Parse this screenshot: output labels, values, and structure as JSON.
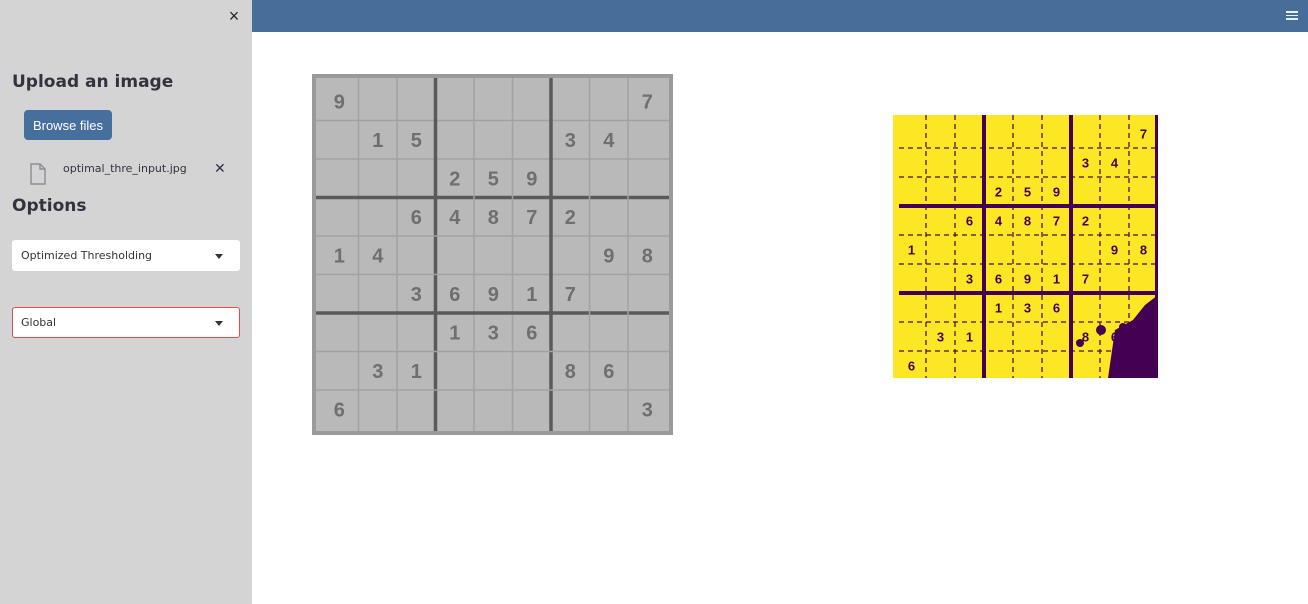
{
  "sidebar": {
    "close_icon": "close-icon",
    "upload_heading": "Upload an image",
    "browse_label": "Browse files",
    "file_name": "optimal_thre_input.jpg",
    "file_icon": "file-icon",
    "file_remove_icon": "close-icon",
    "options_heading": "Options",
    "method_select": {
      "value": "Optimized Thresholding"
    },
    "scope_select": {
      "value": "Global"
    }
  },
  "header": {
    "menu_icon": "hamburger-menu-icon",
    "color": "#476d99"
  },
  "images": {
    "input": {
      "grid": [
        [
          "9",
          "",
          "",
          "",
          "",
          "",
          "",
          "",
          "7"
        ],
        [
          "",
          "1",
          "5",
          "",
          "",
          "",
          "3",
          "4",
          ""
        ],
        [
          "",
          "",
          "",
          "2",
          "5",
          "9",
          "",
          "",
          ""
        ],
        [
          "",
          "",
          "6",
          "4",
          "8",
          "7",
          "2",
          "",
          ""
        ],
        [
          "1",
          "4",
          "",
          "",
          "",
          "",
          "",
          "9",
          "8"
        ],
        [
          "",
          "",
          "3",
          "6",
          "9",
          "1",
          "7",
          "",
          ""
        ],
        [
          "",
          "",
          "",
          "1",
          "3",
          "6",
          "",
          "",
          ""
        ],
        [
          "",
          "3",
          "1",
          "",
          "",
          "",
          "8",
          "6",
          ""
        ],
        [
          "6",
          "",
          "",
          "",
          "",
          "",
          "",
          "",
          "3"
        ]
      ]
    },
    "output": {
      "foreground": "#440154",
      "background": "#fde725",
      "digits": [
        {
          "t": "7",
          "c": 8,
          "r": 0
        },
        {
          "t": "3",
          "c": 6,
          "r": 1
        },
        {
          "t": "4",
          "c": 7,
          "r": 1
        },
        {
          "t": "2",
          "c": 3,
          "r": 2
        },
        {
          "t": "5",
          "c": 4,
          "r": 2
        },
        {
          "t": "9",
          "c": 5,
          "r": 2
        },
        {
          "t": "6",
          "c": 2,
          "r": 3
        },
        {
          "t": "4",
          "c": 3,
          "r": 3
        },
        {
          "t": "8",
          "c": 4,
          "r": 3
        },
        {
          "t": "7",
          "c": 5,
          "r": 3
        },
        {
          "t": "2",
          "c": 6,
          "r": 3
        },
        {
          "t": "1",
          "c": 0,
          "r": 4
        },
        {
          "t": "9",
          "c": 7,
          "r": 4
        },
        {
          "t": "8",
          "c": 8,
          "r": 4
        },
        {
          "t": "3",
          "c": 2,
          "r": 5
        },
        {
          "t": "6",
          "c": 3,
          "r": 5
        },
        {
          "t": "9",
          "c": 4,
          "r": 5
        },
        {
          "t": "1",
          "c": 5,
          "r": 5
        },
        {
          "t": "7",
          "c": 6,
          "r": 5
        },
        {
          "t": "1",
          "c": 3,
          "r": 6
        },
        {
          "t": "3",
          "c": 4,
          "r": 6
        },
        {
          "t": "6",
          "c": 5,
          "r": 6
        },
        {
          "t": "3",
          "c": 1,
          "r": 7
        },
        {
          "t": "1",
          "c": 2,
          "r": 7
        },
        {
          "t": "8",
          "c": 6,
          "r": 7
        },
        {
          "t": "6",
          "c": 7,
          "r": 7
        },
        {
          "t": "6",
          "c": 0,
          "r": 8
        }
      ]
    }
  }
}
